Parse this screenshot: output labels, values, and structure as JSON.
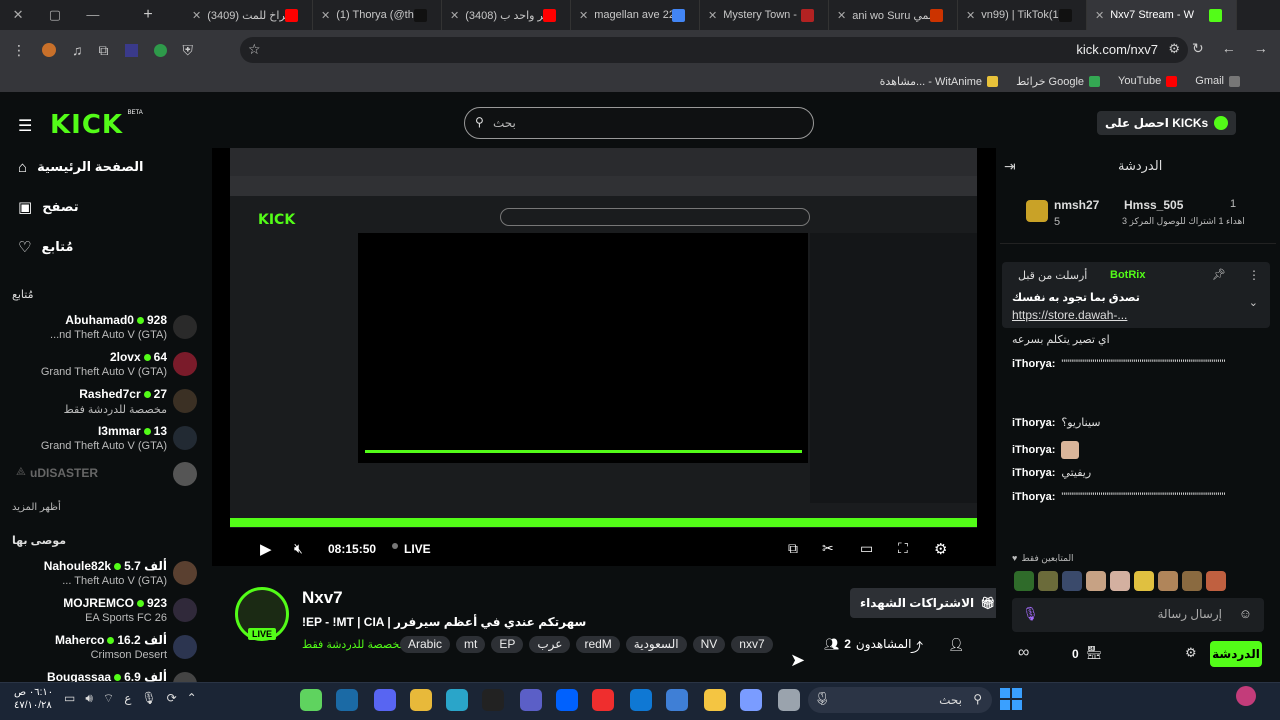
{
  "browser": {
    "tabs": [
      {
        "label": "(3409) صراخ للمت",
        "color": "#ff0000"
      },
      {
        "label": "(1) Thorya (@the",
        "color": "#111111"
      },
      {
        "label": "(3408) آخر واحد ب",
        "color": "#ff0000"
      },
      {
        "label": "magellan ave 22",
        "color": "#4285f4"
      },
      {
        "label": "Mystery Town -",
        "color": "#b22222"
      },
      {
        "label": "ani wo Suru انمي",
        "color": "#cc3300"
      },
      {
        "label": "vn99) | TikTok(1)",
        "color": "#111111"
      },
      {
        "label": "Nxv7 Stream - W",
        "color": "#53fc18"
      }
    ],
    "url": "kick.com/nxv7",
    "bookmarks": [
      {
        "label": "Gmail"
      },
      {
        "label": "YouTube"
      },
      {
        "label": "خرائط Google"
      },
      {
        "label": "مشاهدة... - WitAnime"
      }
    ]
  },
  "header": {
    "logo": "KICK",
    "logo_badge": "BETA",
    "search_placeholder": "بحث",
    "get_kicks": "احصل على KICKs"
  },
  "sidebar": {
    "nav": [
      {
        "label": "الصفحة الرئيسية",
        "icon": "home-icon"
      },
      {
        "label": "تصفح",
        "icon": "browse-icon"
      },
      {
        "label": "مُتابع",
        "icon": "heart-icon"
      }
    ],
    "following_title": "مُتابع",
    "following": [
      {
        "viewers": "928",
        "name": "Abuhamad0",
        "game": "...nd Theft Auto V (GTA)",
        "color": "#2a2a2a"
      },
      {
        "viewers": "64",
        "name": "2lovx",
        "game": "Grand Theft Auto V (GTA)",
        "color": "#7a1b2a"
      },
      {
        "viewers": "27",
        "name": "Rashed7cr",
        "game": "مخصصة للدردشة فقط",
        "color": "#3b3024"
      },
      {
        "viewers": "13",
        "name": "I3mmar",
        "game": "Grand Theft Auto V (GTA)",
        "color": "#222a33"
      }
    ],
    "offline_name": "uDISASTER",
    "show_more": "أظهر المزيد",
    "recommended_title": "موصى بها",
    "recommended": [
      {
        "viewers": "5.7 ألف",
        "name": "Nahoule82k",
        "game": "... Theft Auto V (GTA)",
        "color": "#5a4030"
      },
      {
        "viewers": "923",
        "name": "MOJREMCO",
        "game": "EA Sports FC 26",
        "color": "#30293a"
      },
      {
        "viewers": "16.2 ألف",
        "name": "Maherco",
        "game": "Crimson Desert",
        "color": "#2c3550"
      },
      {
        "viewers": "6.9 ألف",
        "name": "Bougassaa",
        "game": "",
        "color": "#444444"
      }
    ]
  },
  "player": {
    "time": "08:15:50",
    "live": "LIVE"
  },
  "stream": {
    "channel": "Nxv7",
    "title": "!EP - !MT | CIA | سهرتكم عندي في أعظم سيرفرر",
    "category": "مخصصة للدردشة فقط",
    "tags": [
      "Arabic",
      "mt",
      "EP",
      "عرب",
      "redM",
      "السعودية",
      "NV",
      "nxv7"
    ],
    "viewers_label": "المشاهدون",
    "viewers": "2",
    "subscribe_label": "الاشتراكات الشهداء",
    "live_badge": "LIVE"
  },
  "chat": {
    "title": "الدردشة",
    "leaderboard": [
      {
        "name": "nmsh27",
        "value": "5",
        "rank": "1"
      },
      {
        "name": "Hmss_505",
        "value": "1",
        "note": "اهداء 1 اشتراك للوصول المركز 3"
      }
    ],
    "pinned_by": "أرسلت من قبل",
    "pinned_user": "BotRix",
    "pinned_text": "تصدق بما تجود به نفسك",
    "pinned_link": "https://store.dawah-...",
    "messages": [
      {
        "user": "",
        "text": "اي تصير يتكلم بسرعه"
      },
      {
        "user": "iThorya:",
        "text": "\"\"\"\"\"\"\"\"\"\"\"\"\"\"\"\"\"\"\"\"\"\"\"\"\"\"\"\"\"\"\"\"\"\"\"\"\"\"\"\"\"\""
      },
      {
        "user": "iThorya:",
        "text": "سيناريو؟"
      },
      {
        "user": "iThorya:",
        "text": ""
      },
      {
        "user": "iThorya:",
        "text": "ريفيتي"
      },
      {
        "user": "iThorya:",
        "text": "\"\"\"\"\"\"\"\"\"\"\"\"\"\"\"\"\"\"\"\"\"\"\"\"\"\"\"\"\"\"\"\"\"\"\"\"\"\"\"\"\"\""
      }
    ],
    "followers_only": "المتابعين فقط",
    "input_placeholder": "إرسال رسالة",
    "send_label": "الدردشة",
    "points": "0"
  },
  "taskbar": {
    "search_label": "بحث",
    "time": "٠٦:١٠ ص",
    "date": "٤٧/١٠/٢٨",
    "lang": "ع"
  }
}
